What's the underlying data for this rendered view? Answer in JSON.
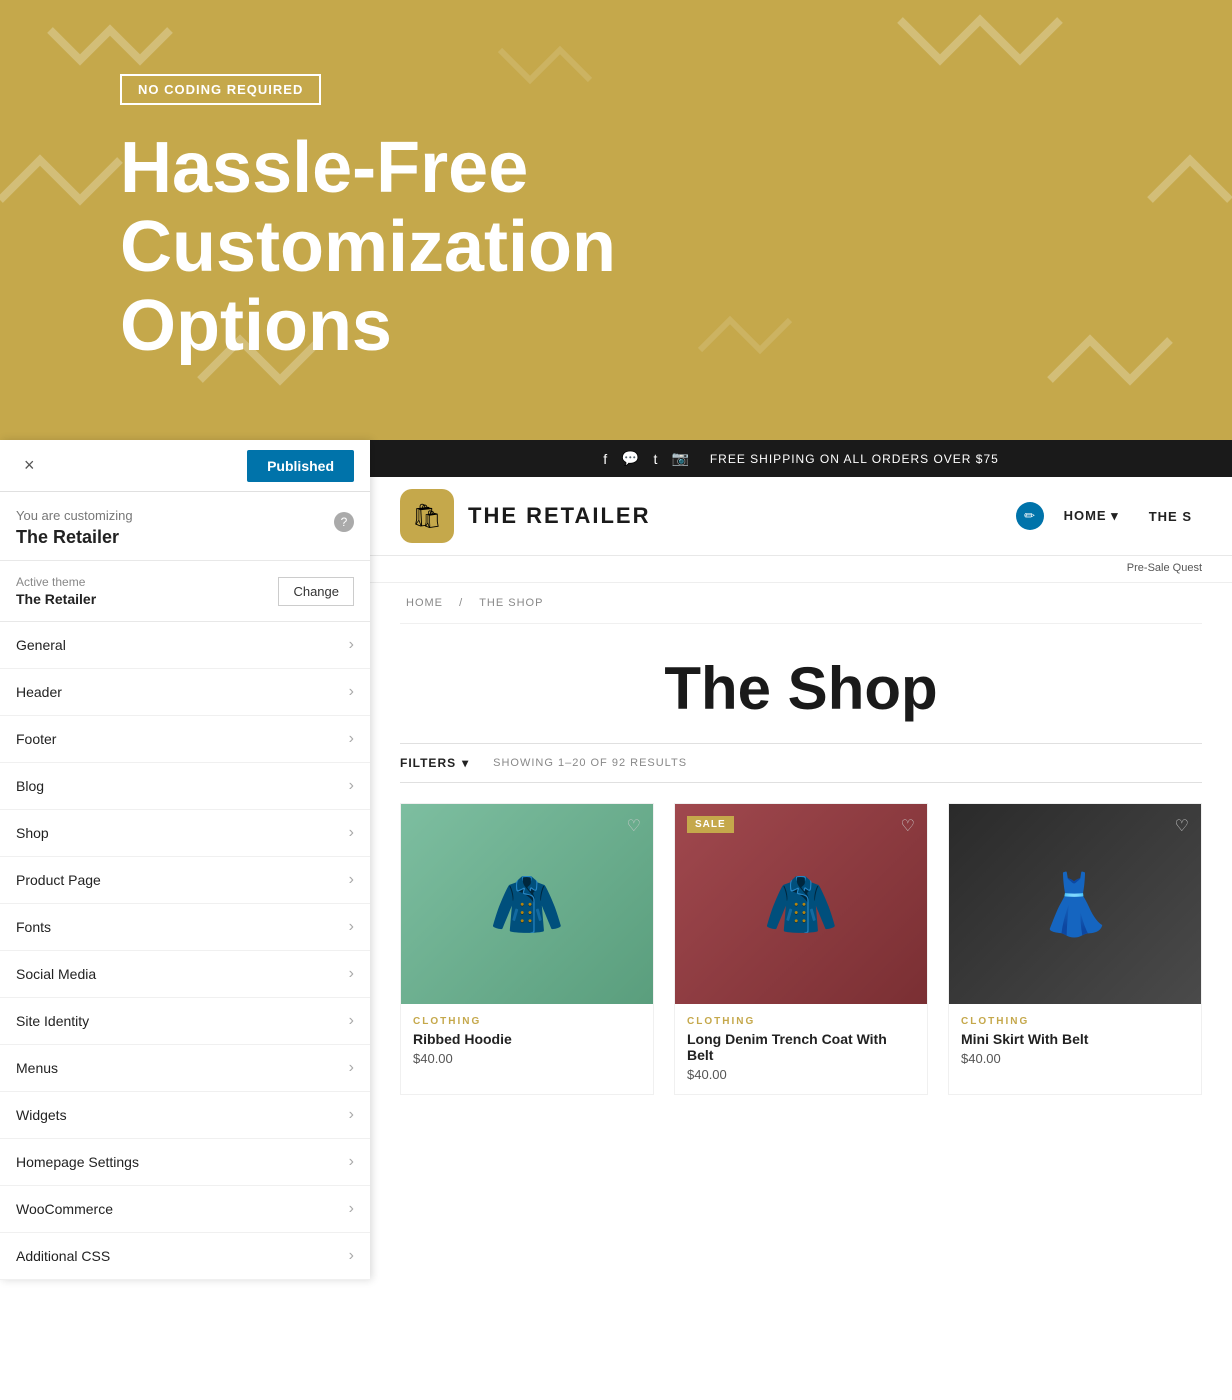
{
  "hero": {
    "badge": "NO CODING REQUIRED",
    "title_line1": "Hassle-Free",
    "title_line2": "Customization Options"
  },
  "customizer": {
    "close_label": "×",
    "published_label": "Published",
    "customizing_label": "You are customizing",
    "theme_name": "The Retailer",
    "help_label": "?",
    "active_theme_label": "Active theme",
    "active_theme_name": "The Retailer",
    "change_label": "Change",
    "menu_items": [
      {
        "id": "general",
        "label": "General"
      },
      {
        "id": "header",
        "label": "Header"
      },
      {
        "id": "footer",
        "label": "Footer"
      },
      {
        "id": "blog",
        "label": "Blog"
      },
      {
        "id": "shop",
        "label": "Shop"
      },
      {
        "id": "product-page",
        "label": "Product Page"
      },
      {
        "id": "fonts",
        "label": "Fonts"
      },
      {
        "id": "social-media",
        "label": "Social Media"
      },
      {
        "id": "site-identity",
        "label": "Site Identity"
      },
      {
        "id": "menus",
        "label": "Menus"
      },
      {
        "id": "widgets",
        "label": "Widgets"
      },
      {
        "id": "homepage-settings",
        "label": "Homepage Settings"
      },
      {
        "id": "woocommerce",
        "label": "WooCommerce"
      },
      {
        "id": "additional-css",
        "label": "Additional CSS"
      }
    ]
  },
  "top_bar": {
    "shipping_text": "FREE SHIPPING ON ALL ORDERS OVER $75",
    "social_icons": [
      "f",
      "💬",
      "t",
      "📷"
    ]
  },
  "site_header": {
    "logo_icon": "🛍",
    "logo_text": "THE RETAILER",
    "nav_items": [
      {
        "label": "HOME",
        "has_dropdown": true
      },
      {
        "label": "THE S",
        "has_dropdown": false
      }
    ],
    "pre_sale_label": "Pre-Sale Quest"
  },
  "shop": {
    "breadcrumb_home": "HOME",
    "breadcrumb_separator": "/",
    "breadcrumb_current": "THE SHOP",
    "title": "The Shop",
    "filters_label": "FILTERS",
    "results_text": "SHOWING 1–20 OF 92 RESULTS",
    "products": [
      {
        "id": "ribbed-hoodie",
        "category": "CLOTHING",
        "name": "Ribbed Hoodie",
        "price": "$40.00",
        "sale": false,
        "color": "green"
      },
      {
        "id": "long-coat",
        "category": "CLOTHING",
        "name": "Long Denim Trench Coat With Belt",
        "price": "$40.00",
        "sale": true,
        "color": "red"
      },
      {
        "id": "mini-skirt",
        "category": "CLOTHING",
        "name": "Mini Skirt With Belt",
        "price": "$40.00",
        "sale": false,
        "color": "black"
      }
    ],
    "sale_label": "SALE"
  },
  "colors": {
    "brand_gold": "#c5a84b",
    "black": "#1a1a1a",
    "published_blue": "#0073aa"
  }
}
